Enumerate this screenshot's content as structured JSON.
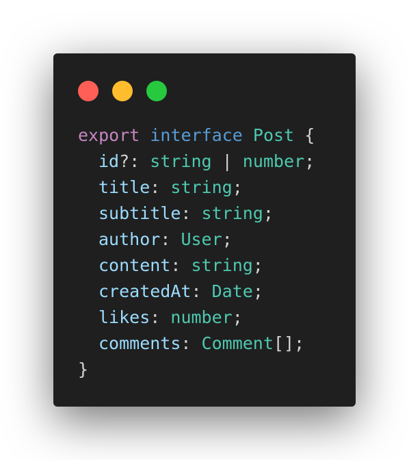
{
  "window": {
    "controls": [
      {
        "name": "close",
        "color": "#ff5f56"
      },
      {
        "name": "minimize",
        "color": "#ffbd2e"
      },
      {
        "name": "maximize",
        "color": "#27c93f"
      }
    ]
  },
  "code": {
    "declaration": {
      "export_kw": "export",
      "interface_kw": "interface",
      "name": "Post",
      "open_brace": "{"
    },
    "fields": [
      {
        "prop": "id",
        "optional": "?:",
        "type": "string",
        "union_sep": "|",
        "union_type": "number",
        "end": ";"
      },
      {
        "prop": "title",
        "sep": ":",
        "type": "string",
        "end": ";"
      },
      {
        "prop": "subtitle",
        "sep": ":",
        "type": "string",
        "end": ";"
      },
      {
        "prop": "author",
        "sep": ":",
        "type": "User",
        "end": ";"
      },
      {
        "prop": "content",
        "sep": ":",
        "type": "string",
        "end": ";"
      },
      {
        "prop": "createdAt",
        "sep": ":",
        "type": "Date",
        "end": ";"
      },
      {
        "prop": "likes",
        "sep": ":",
        "type": "number",
        "end": ";"
      },
      {
        "prop": "comments",
        "sep": ":",
        "type": "Comment",
        "suffix": "[]",
        "end": ";"
      }
    ],
    "close_brace": "}"
  },
  "colors": {
    "background": "#1f1f1f",
    "keyword_export": "#c586c0",
    "keyword_interface": "#569cd6",
    "type": "#4ec9b0",
    "property": "#9cdcfe",
    "punctuation": "#d4d4d4"
  }
}
